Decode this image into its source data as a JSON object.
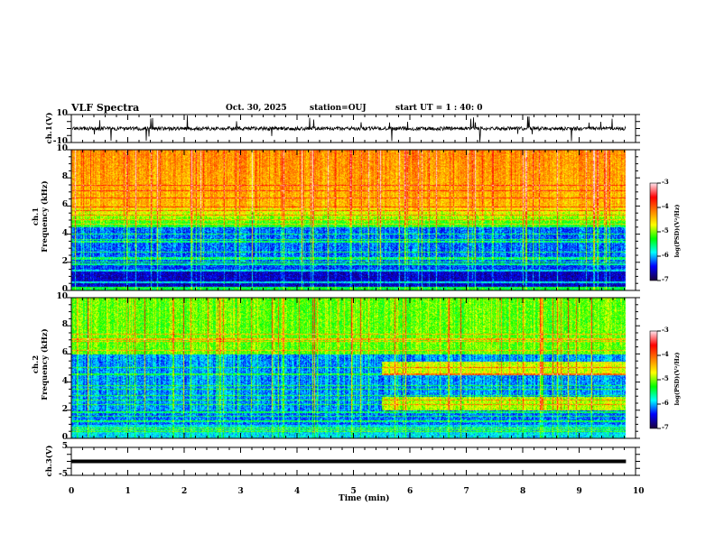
{
  "header": {
    "title": "VLF Spectra",
    "date": "Oct. 30, 2025",
    "station": "station=OUJ",
    "start_ut": "start  UT =   1 : 40: 0"
  },
  "chart_data": [
    {
      "type": "line",
      "panel": "ch1-waveform",
      "ylabel": "ch.1(V)",
      "ylim": [
        -10,
        10
      ],
      "yticks": [
        "10",
        "-10"
      ],
      "xlim": [
        0,
        10
      ],
      "description_level": "noise near 0 V with impulsive spikes"
    },
    {
      "type": "heatmap",
      "panel": "ch1-spectrogram",
      "ylabel": "ch.1\nFrequency (kHz)",
      "ylabel_top": "ch.1",
      "ylabel_main": "Frequency (kHz)",
      "ylim": [
        0,
        10
      ],
      "yticks": [
        "0",
        "2",
        "4",
        "6",
        "8",
        "10"
      ],
      "xlim": [
        0,
        10
      ],
      "colorbar": {
        "label": "log(PSD)(V²/Hz)",
        "range": [
          -7,
          -3
        ],
        "ticks": [
          "-3",
          "-4",
          "-5",
          "-6",
          "-7"
        ]
      }
    },
    {
      "type": "heatmap",
      "panel": "ch2-spectrogram",
      "ylabel_top": "ch.2",
      "ylabel_main": "Frequency (kHz)",
      "ylim": [
        0,
        10
      ],
      "yticks": [
        "0",
        "2",
        "4",
        "6",
        "8",
        "10"
      ],
      "xlim": [
        0,
        10
      ],
      "colorbar": {
        "label": "log(PSD)(V²/Hz)",
        "range": [
          -7,
          -3
        ],
        "ticks": [
          "-3",
          "-4",
          "-5",
          "-6",
          "-7"
        ]
      },
      "band_onset_min": 5.5,
      "bands_khz": [
        [
          4.5,
          5.5
        ],
        [
          2,
          3
        ]
      ]
    },
    {
      "type": "line",
      "panel": "ch3-waveform",
      "ylabel": "ch.3(V)",
      "ylim": [
        -5,
        5
      ],
      "yticks": [
        "5",
        "-5"
      ],
      "xlim": [
        0,
        10
      ],
      "value": 0,
      "data_end_min": 9.83
    },
    {
      "xlabel": "Time (min)",
      "xticks": [
        "0",
        "1",
        "2",
        "3",
        "4",
        "5",
        "6",
        "7",
        "8",
        "9",
        "10"
      ]
    }
  ],
  "colors": {
    "colormap": [
      "#1a0040",
      "#0000ff",
      "#00ffff",
      "#00ff00",
      "#ffff00",
      "#ff8000",
      "#ff0000",
      "#ffe0e8"
    ]
  }
}
